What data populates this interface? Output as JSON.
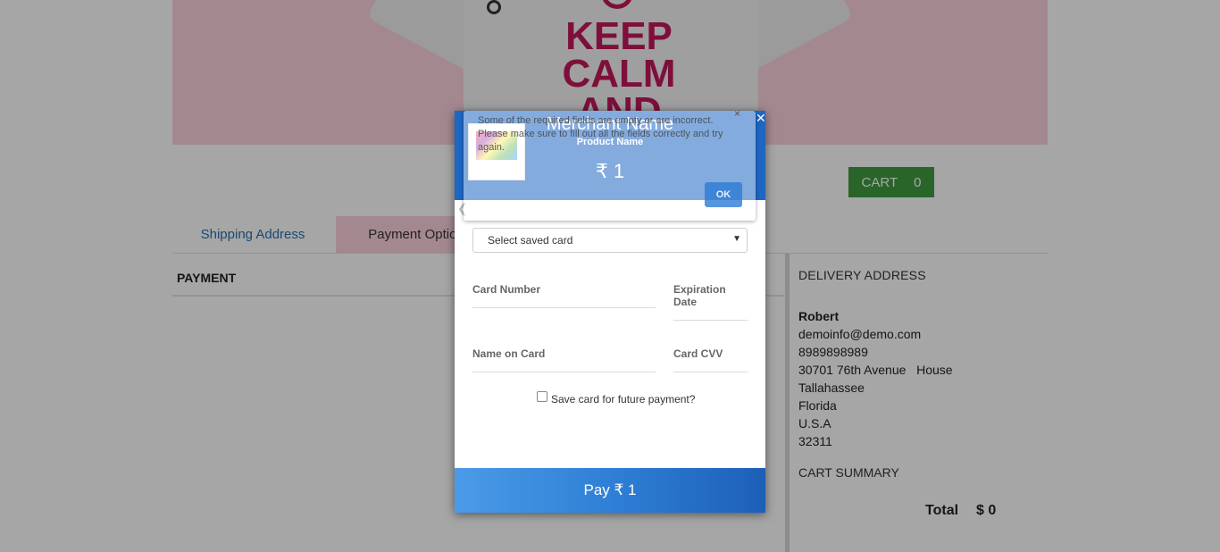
{
  "hero": {
    "shirt_lines": [
      "KEEP",
      "CALM",
      "AND"
    ]
  },
  "cart": {
    "label": "CART",
    "count": "0"
  },
  "tabs": {
    "shipping": "Shipping Address",
    "payment": "Payment Option"
  },
  "payment_section": {
    "title": "PAYMENT"
  },
  "delivery": {
    "title": "DELIVERY ADDRESS",
    "name": "Robert",
    "email": "demoinfo@demo.com",
    "phone": "8989898989",
    "street": "30701 76th Avenue   House",
    "city": "Tallahassee",
    "state": "Florida",
    "country": "U.S.A",
    "zip": "32311"
  },
  "cart_summary": {
    "title": "CART SUMMARY",
    "total_label": "Total",
    "total_value": "$ 0"
  },
  "checkout": {
    "merchant_name": "Merchant Name",
    "product_name": "Product Name",
    "amount": "₹ 1",
    "close": "✕",
    "saved_card_placeholder": "Select saved card",
    "card_number_label": "Card Number",
    "expiration_label": "Expiration Date",
    "name_on_card_label": "Name on Card",
    "cvv_label": "Card CVV",
    "save_card_label": "Save card for future payment?",
    "pay_label": "Pay ₹ 1"
  },
  "alert": {
    "message": "Some of the required fields are empty or are incorrect. Please make sure to fill out all the fields correctly and try again.",
    "close": "×",
    "ok_label": "OK"
  },
  "colors": {
    "hero_bg": "#fbd3dc",
    "cart_green": "#3f9b3f",
    "header_blue": "#1e66c3",
    "link_blue": "#2a6fb4",
    "shirt_text": "#c2185b"
  }
}
